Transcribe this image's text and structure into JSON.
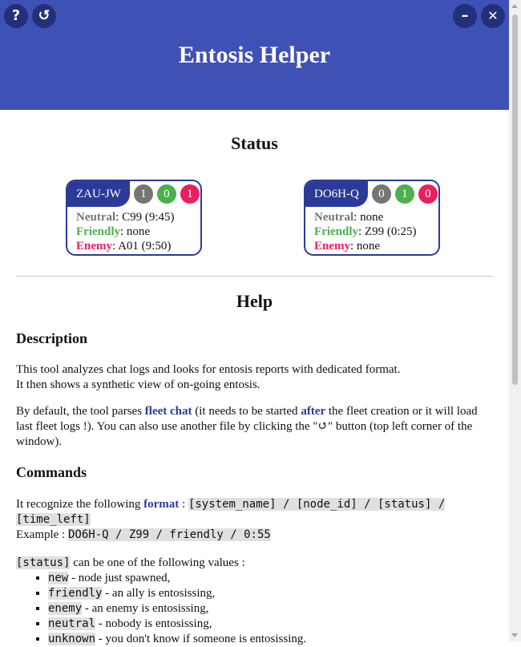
{
  "header": {
    "title": "Entosis Helper",
    "help_label": "?",
    "refresh_label": "↺",
    "minimize_label": "–",
    "close_label": "✕"
  },
  "status": {
    "title": "Status",
    "systems": [
      {
        "name": "ZAU-JW",
        "counts": [
          "1",
          "0",
          "1"
        ],
        "neutral_label": "Neutral",
        "neutral_value": ": C99 (9:45)",
        "friendly_label": "Friendly",
        "friendly_value": ": none",
        "enemy_label": "Enemy",
        "enemy_value": ": A01 (9:50)"
      },
      {
        "name": "DO6H-Q",
        "counts": [
          "0",
          "1",
          "0"
        ],
        "neutral_label": "Neutral",
        "neutral_value": ": none",
        "friendly_label": "Friendly",
        "friendly_value": ": Z99 (0:25)",
        "enemy_label": "Enemy",
        "enemy_value": ": none"
      }
    ]
  },
  "help": {
    "title": "Help",
    "description_title": "Description",
    "desc_line1": "This tool analyzes chat logs and looks for entosis reports with dedicated format.",
    "desc_line2": "It then shows a synthetic view of on-going entosis.",
    "default_p1": "By default, the tool parses ",
    "fleet_chat": "fleet chat",
    "default_p2": " (it needs to be started ",
    "after": "after",
    "default_p3": " the fleet creation or it will load last fleet logs !). You can also use another file by clicking the \"↺\" button (top left corner of the window).",
    "commands_title": "Commands",
    "recognize_prefix": "It recognize the following ",
    "format_word": "format",
    "recognize_sep": " : ",
    "format_code": "[system_name] / [node_id] / [status] / [time_left]",
    "example_prefix": "Example : ",
    "example_code": "DO6H-Q / Z99 / friendly / 0:55",
    "status_code": "[status]",
    "status_text": " can be one of the following values :",
    "values": [
      {
        "code": "new",
        "text": " - node just spawned,"
      },
      {
        "code": "friendly",
        "text": " - an ally is entosissing,"
      },
      {
        "code": "enemy",
        "text": " - an enemy is entosissing,"
      },
      {
        "code": "neutral",
        "text": " - nobody is entosissing,"
      },
      {
        "code": "unknown",
        "text": " - you don't know if someone is entosissing."
      }
    ]
  }
}
